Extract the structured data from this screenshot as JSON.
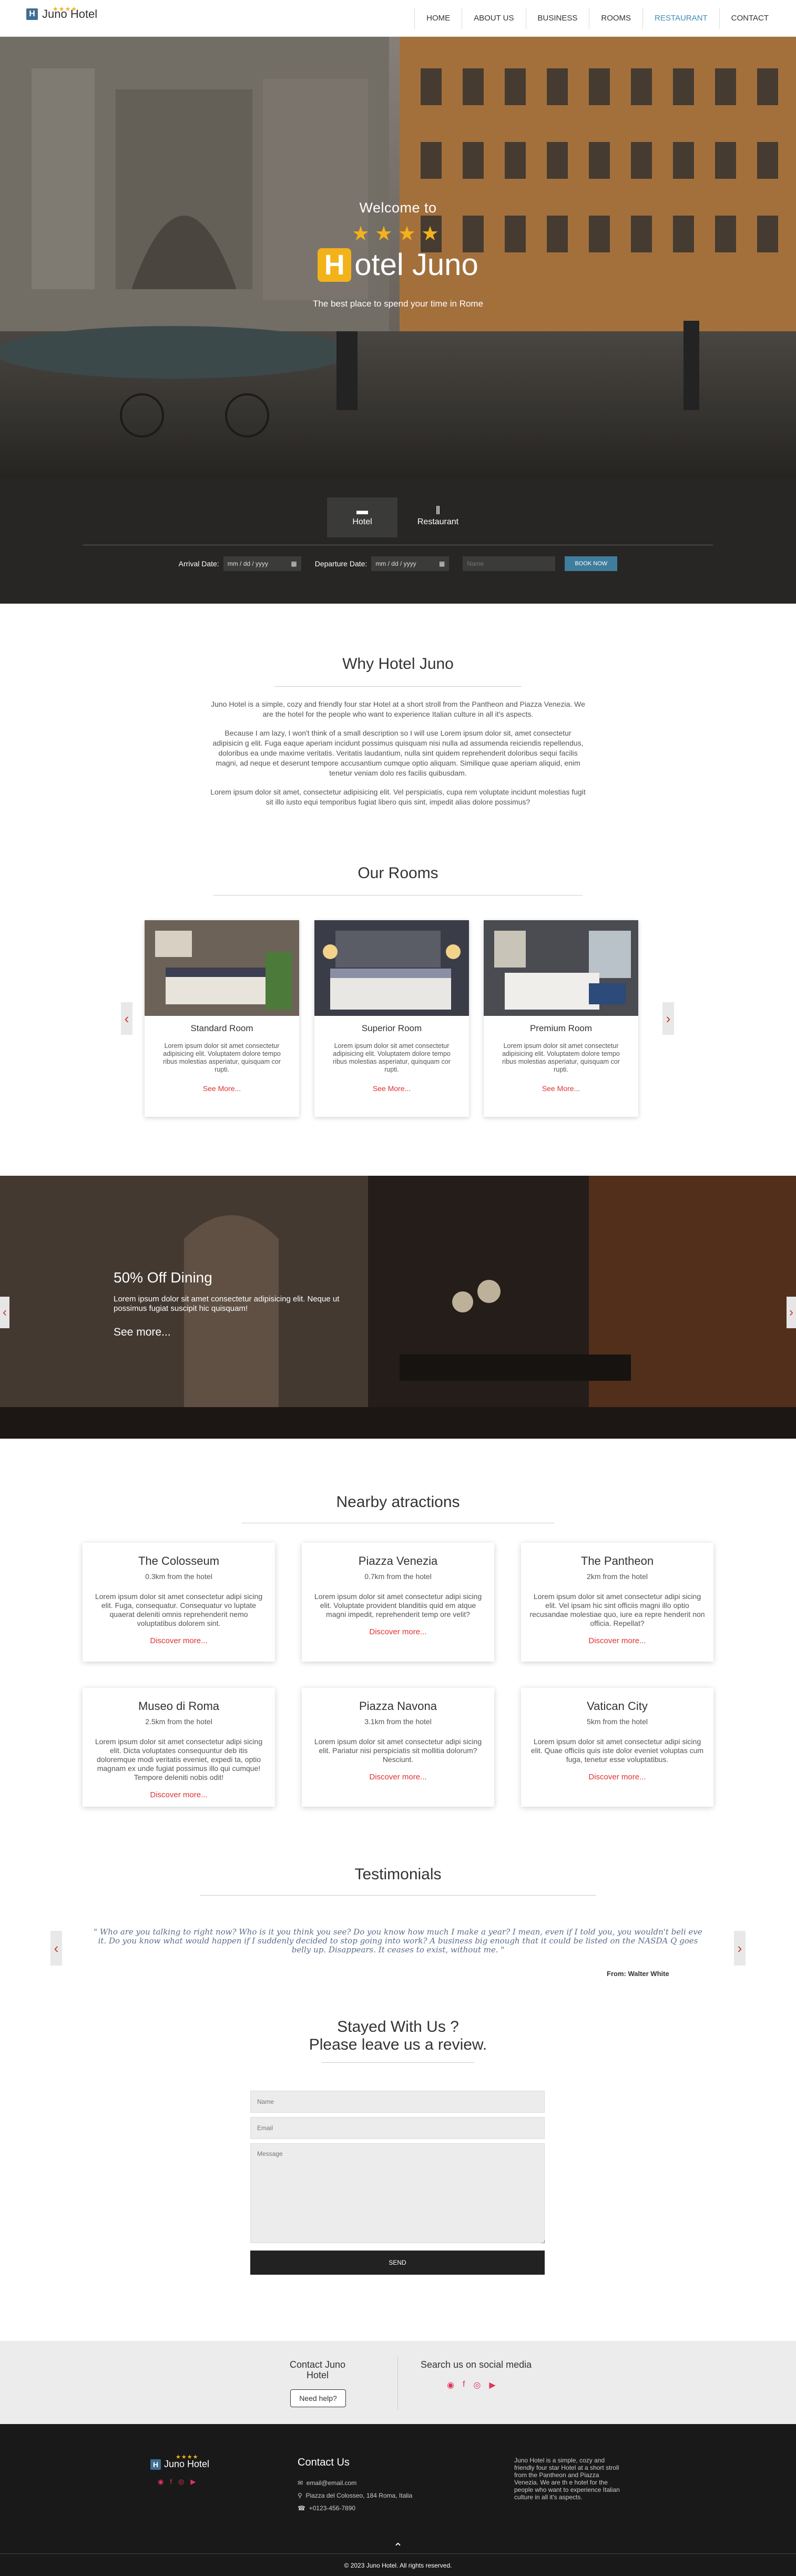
{
  "brand": {
    "name": "Juno Hotel",
    "letter": "H"
  },
  "nav": {
    "items": [
      {
        "label": "HOME"
      },
      {
        "label": "ABOUT US"
      },
      {
        "label": "BUSINESS"
      },
      {
        "label": "ROOMS"
      },
      {
        "label": "RESTAURANT",
        "active": true
      },
      {
        "label": "CONTACT"
      }
    ]
  },
  "hero": {
    "welcome": "Welcome to",
    "stars": "★★★★",
    "letter": "H",
    "title": "otel Juno",
    "tagline": "The best place to spend your time in Rome"
  },
  "booking": {
    "tabs": [
      {
        "label": "Hotel",
        "icon": "bed-icon"
      },
      {
        "label": "Restaurant",
        "icon": "utensils-icon"
      }
    ],
    "arrival_label": "Arrival Date:",
    "departure_label": "Departure Date:",
    "date_placeholder": "mm / dd / yyyy",
    "name_placeholder": "Name",
    "button": "BOOK NOW"
  },
  "why": {
    "title": "Why Hotel Juno",
    "p1": "Juno Hotel is a simple, cozy and friendly four star Hotel at a short stroll from the Pantheon and Piazza Venezia. We are the hotel for the people who want to experience Italian culture in all it's aspects.",
    "p2": "Because I am lazy, I won't think of a small description so I will use Lorem ipsum dolor sit, amet consectetur adipisicin g elit. Fuga eaque aperiam incidunt possimus quisquam nisi nulla ad assumenda reiciendis repellendus, doloribus ea unde maxime veritatis. Veritatis laudantium, nulla sint quidem reprehenderit doloribus sequi facilis magni, ad neque et deserunt tempore accusantium cumque optio aliquam. Similique quae aperiam aliquid, enim tenetur veniam dolo res facilis quibusdam.",
    "p3": "Lorem ipsum dolor sit amet, consectetur adipisicing elit. Vel perspiciatis, cupa rem voluptate incidunt molestias fugit sit illo iusto equi temporibus fugiat libero quis sint, impedit alias dolore possimus?"
  },
  "rooms": {
    "title": "Our Rooms",
    "items": [
      {
        "title": "Standard Room",
        "text": "Lorem ipsum dolor sit amet consectetur adipisicing elit. Voluptatem dolore tempo ribus molestias asperiatur, quisquam cor rupti.",
        "more": "See More..."
      },
      {
        "title": "Superior Room",
        "text": "Lorem ipsum dolor sit amet consectetur adipisicing elit. Voluptatem dolore tempo ribus molestias asperiatur, quisquam cor rupti.",
        "more": "See More..."
      },
      {
        "title": "Premium Room",
        "text": "Lorem ipsum dolor sit amet consectetur adipisicing elit. Voluptatem dolore tempo ribus molestias asperiatur, quisquam cor rupti.",
        "more": "See More..."
      }
    ],
    "prev": "‹",
    "next": "›"
  },
  "dining": {
    "title": "50% Off Dining",
    "text": "Lorem ipsum dolor sit amet consectetur adipisicing elit. Neque ut possimus fugiat suscipit hic quisquam!",
    "more": "See more...",
    "prev": "‹",
    "next": "›"
  },
  "attractions": {
    "title": "Nearby atractions",
    "items": [
      {
        "title": "The Colosseum",
        "dist": "0.3km from the hotel",
        "text": "Lorem ipsum dolor sit amet consectetur adipi sicing elit. Fuga, consequatur. Consequatur vo luptate quaerat deleniti omnis reprehenderit nemo voluptatibus dolorem sint.",
        "more": "Discover more..."
      },
      {
        "title": "Piazza Venezia",
        "dist": "0.7km from the hotel",
        "text": "Lorem ipsum dolor sit amet consectetur adipi sicing elit. Voluptate provident blanditiis quid em atque magni impedit, reprehenderit temp ore velit?",
        "more": "Discover more..."
      },
      {
        "title": "The Pantheon",
        "dist": "2km from the hotel",
        "text": "Lorem ipsum dolor sit amet consectetur adipi sicing elit. Vel ipsam hic sint officiis magni illo optio recusandae molestiae quo, iure ea repre henderit non officia. Repellat?",
        "more": "Discover more..."
      },
      {
        "title": "Museo di Roma",
        "dist": "2.5km from the hotel",
        "text": "Lorem ipsum dolor sit amet consectetur adipi sicing elit. Dicta voluptates consequuntur deb itis doloremque modi veritatis eveniet, expedi ta, optio magnam ex unde fugiat possimus illo qui cumque! Tempore deleniti nobis odit!",
        "more": "Discover more..."
      },
      {
        "title": "Piazza Navona",
        "dist": "3.1km from the hotel",
        "text": "Lorem ipsum dolor sit amet consectetur adipi sicing elit. Pariatur nisi perspiciatis sit mollitia dolorum? Nesciunt.",
        "more": "Discover more..."
      },
      {
        "title": "Vatican City",
        "dist": "5km from the hotel",
        "text": "Lorem ipsum dolor sit amet consectetur adipi sicing elit. Quae officiis quis iste dolor eveniet voluptas cum fuga, tenetur esse voluptatibus.",
        "more": "Discover more..."
      }
    ]
  },
  "testimonials": {
    "title": "Testimonials",
    "quote": "\" Who are you talking to right now? Who is it you think you see? Do you know how much I make a year? I mean, even if I told you, you wouldn't beli eve it. Do you know what would happen if I suddenly decided to stop going into work? A business big enough that it could be listed on the NASDA Q goes belly up. Disappears. It ceases to exist, without me. \"",
    "author": "From: Walter White",
    "prev": "‹",
    "next": "›"
  },
  "review": {
    "title_line1": "Stayed With Us ?",
    "title_line2": "Please leave us a review.",
    "name_placeholder": "Name",
    "email_placeholder": "Email",
    "message_placeholder": "Message",
    "send": "SEND"
  },
  "contact_band": {
    "title": "Contact Juno Hotel",
    "button": "Need help?",
    "social_title": "Search us on social media"
  },
  "footer": {
    "brand": "Juno Hotel",
    "stars": "★★★★",
    "contact_title": "Contact Us",
    "email": "email@email.com",
    "address": "Piazza del Colosseo, 184 Roma, Italia",
    "phone": "+0123-456-7890",
    "about": "Juno Hotel is a simple, cozy and friendly four star Hotel at a short stroll from the Pantheon and Piazza Venezia. We are th e hotel for the people who want to experience Italian culture in all it's aspects.",
    "copyright": "© 2023 Juno Hotel. All rights reserved.",
    "top": "⌃"
  },
  "colors": {
    "accent": "#3f8db5",
    "gold": "#f3b21a",
    "link_red": "#dd3333",
    "dark": "#272624",
    "social": "#e0345a"
  }
}
